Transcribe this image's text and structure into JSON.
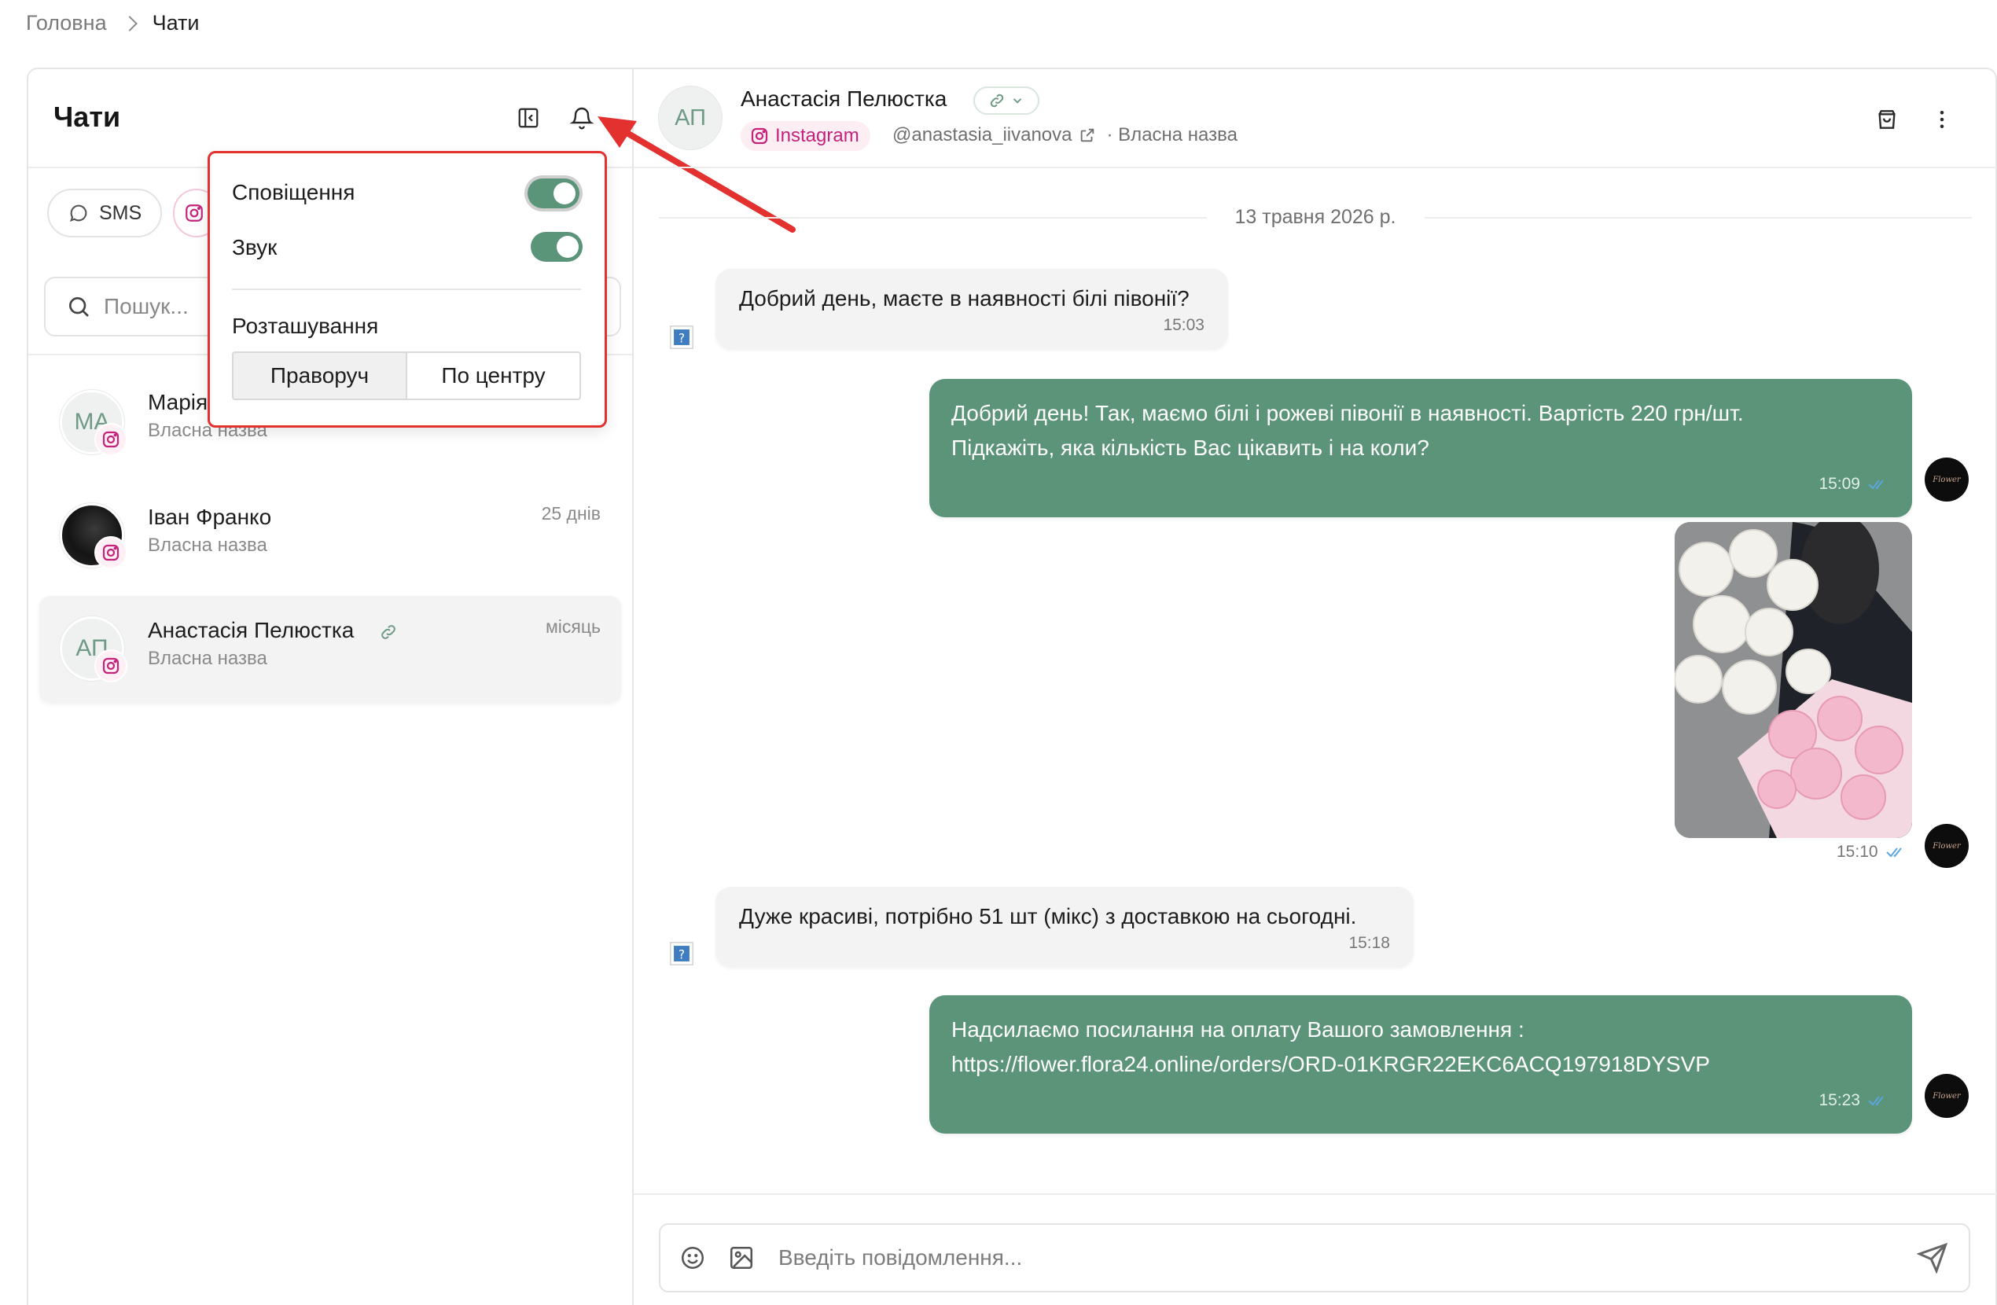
{
  "breadcrumb": {
    "home": "Головна",
    "current": "Чати"
  },
  "left_panel": {
    "title": "Чати",
    "channel_chips": [
      {
        "label": "SMS",
        "icon": "chat-bubble-icon"
      },
      {
        "label": "",
        "icon": "instagram-icon"
      }
    ],
    "search_placeholder": "Пошук...",
    "chats": [
      {
        "initials": "МА",
        "name": "Марія",
        "subtitle": "Власна назва",
        "time": "",
        "channel": "instagram"
      },
      {
        "initials": "",
        "name": "Іван Франко",
        "subtitle": "Власна назва",
        "time": "25 днів",
        "channel": "instagram"
      },
      {
        "initials": "АП",
        "name": "Анастасія Пелюстка",
        "subtitle": "Власна назва",
        "time": "місяць",
        "channel": "instagram",
        "linked": true,
        "active": true
      }
    ]
  },
  "notifications_popup": {
    "notifications_label": "Сповіщення",
    "notifications_on": true,
    "sound_label": "Звук",
    "sound_on": true,
    "position_label": "Розташування",
    "position_options": [
      "Праворуч",
      "По центру"
    ],
    "position_selected": "Праворуч"
  },
  "conversation": {
    "contact_initials": "АП",
    "contact_name": "Анастасія Пелюстка",
    "channel_label": "Instagram",
    "handle": "@anastasia_iivanova",
    "custom_name": "· Власна назва",
    "date_separator": "13 травня 2026 р.",
    "messages": [
      {
        "direction": "in",
        "text": "Добрий день, маєте в наявності білі півонії?",
        "time": "15:03"
      },
      {
        "direction": "out",
        "lines": [
          "Добрий день! Так, маємо білі і рожеві півонії в наявності. Вартість 220 грн/шт.",
          "Підкажіть, яка кількість Вас цікавить і на коли?"
        ],
        "time": "15:09",
        "read": true
      },
      {
        "direction": "out",
        "type": "image",
        "image_desc": "bouquets-of-white-and-pink-peonies",
        "time": "15:10",
        "read": true
      },
      {
        "direction": "in",
        "text": "Дуже красиві, потрібно 51 шт (мікс) з доставкою на сьогодні.",
        "time": "15:18"
      },
      {
        "direction": "out",
        "lines": [
          "Надсилаємо посилання на оплату Вашого замовлення :",
          "https://flower.flora24.online/orders/ORD-01KRGR22EKC6ACQ197918DYSVP"
        ],
        "time": "15:23",
        "read": true
      }
    ],
    "shop_logo_text": "Flower",
    "composer_placeholder": "Введіть повідомлення..."
  },
  "colors": {
    "accent": "#5b9479",
    "instagram": "#c5227b",
    "highlight_border": "#e3312f",
    "arrow": "#e3312f"
  }
}
